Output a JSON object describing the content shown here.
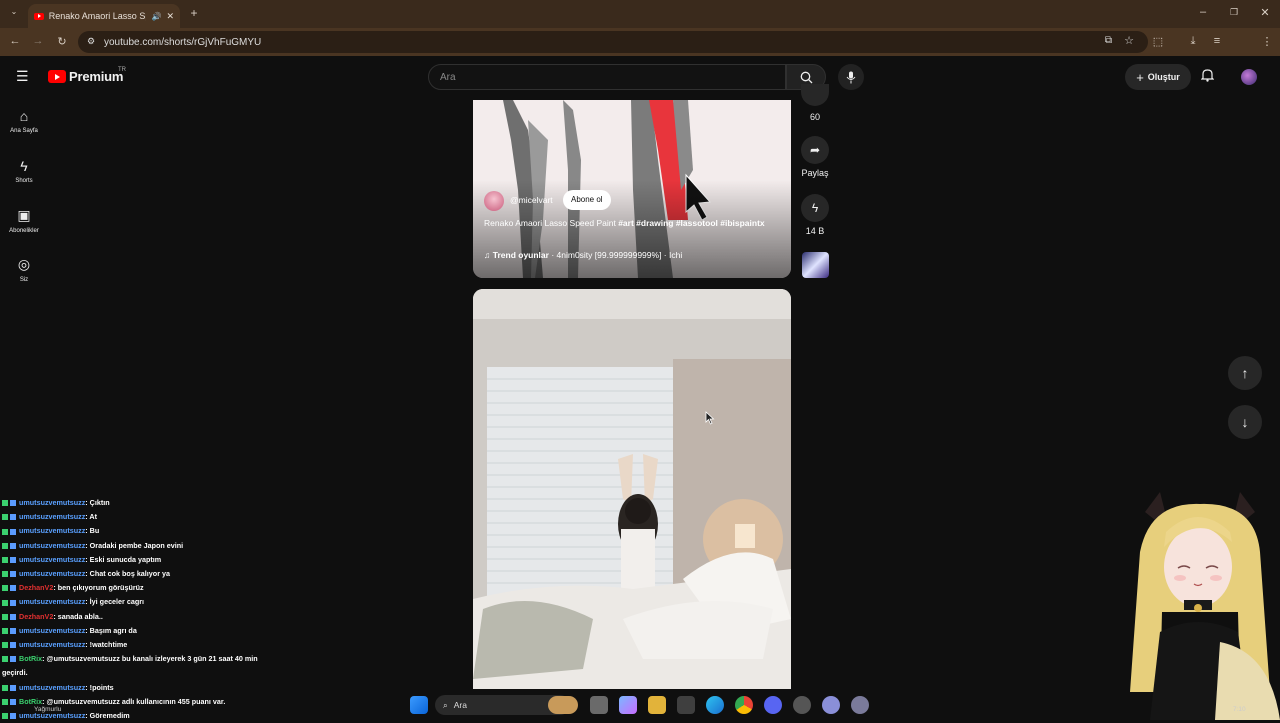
{
  "browser": {
    "tab_title": "Renako Amaori Lasso Speed",
    "url": "youtube.com/shorts/rGjVhFuGMYU"
  },
  "header": {
    "logo_text": "Premium",
    "region": "TR",
    "search_placeholder": "Ara",
    "create_label": "Oluştur"
  },
  "sidebar": {
    "items": [
      {
        "label": "Ana Sayfa",
        "icon": "home-icon"
      },
      {
        "label": "Shorts",
        "icon": "shorts-icon"
      },
      {
        "label": "Abonelikler",
        "icon": "subscriptions-icon"
      },
      {
        "label": "Siz",
        "icon": "profile-icon"
      }
    ]
  },
  "short1": {
    "channel": "@micelvart",
    "subscribe_label": "Abone ol",
    "title": "Renako Amaori Lasso Speed Paint #art #drawing #lassotool #ibispaintx",
    "title_plain": "Renako Amaori Lasso Speed Paint ",
    "hashtags": "#art #drawing #lassotool #ibispaintx",
    "music_bold": "Trend oyunlar",
    "music_rest": " · 4nim0sity [99.999999999%] · Ichi"
  },
  "actions": {
    "comments_count": "60",
    "share_label": "Paylaş",
    "remix_count": "14 B"
  },
  "chat": [
    {
      "user": "umutsuzvemutsuzz",
      "msg": ": Çıktın",
      "color": "#5aa0ff"
    },
    {
      "user": "umutsuzvemutsuzz",
      "msg": ": At",
      "color": "#5aa0ff"
    },
    {
      "user": "umutsuzvemutsuzz",
      "msg": ": Bu",
      "color": "#5aa0ff"
    },
    {
      "user": "umutsuzvemutsuzz",
      "msg": ": Oradaki pembe Japon evini",
      "color": "#5aa0ff"
    },
    {
      "user": "umutsuzvemutsuzz",
      "msg": ": Eski sunucda yaptım",
      "color": "#5aa0ff"
    },
    {
      "user": "umutsuzvemutsuzz",
      "msg": ": Chat cok boş kalıyor ya",
      "color": "#5aa0ff"
    },
    {
      "user": "DezhanV2",
      "msg": ": ben çıkıyorum görüşürüz",
      "color": "#e03030"
    },
    {
      "user": "umutsuzvemutsuzz",
      "msg": ": İyi geceler cagrı",
      "color": "#5aa0ff"
    },
    {
      "user": "DezhanV2",
      "msg": ": sanada abla..",
      "color": "#e03030"
    },
    {
      "user": "umutsuzvemutsuzz",
      "msg": ": Başım agrı da",
      "color": "#5aa0ff"
    },
    {
      "user": "umutsuzvemutsuzz",
      "msg": ": !watchtime",
      "color": "#5aa0ff"
    },
    {
      "user": "BotRix",
      "msg": ": @umutsuzvemutsuzz bu kanalı izleyerek 3 gün 21 saat 40 min",
      "color": "#3bd16f"
    },
    {
      "user": "",
      "msg": "geçirdi.",
      "color": "#5aa0ff"
    },
    {
      "user": "umutsuzvemutsuzz",
      "msg": ": !points",
      "color": "#5aa0ff"
    },
    {
      "user": "BotRix",
      "msg": ": @umutsuzvemutsuzz adlı kullanıcının 455 puanı var.",
      "color": "#3bd16f"
    },
    {
      "user": "umutsuzvemutsuzz",
      "msg": ": Göremedim",
      "color": "#5aa0ff"
    }
  ],
  "taskbar": {
    "search_label": "Ara",
    "weather_label": "Yağmurlu",
    "clock": "7:10"
  }
}
